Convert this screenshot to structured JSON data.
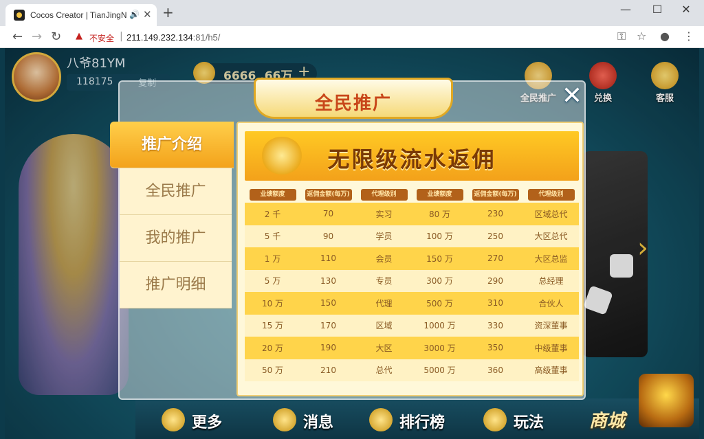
{
  "browser": {
    "tab_title": "Cocos Creator | TianJingNi",
    "url_warning": "不安全",
    "url_host": "211.149.232.134",
    "url_rest": ":81/h5/",
    "url_separator": "|"
  },
  "game": {
    "player": {
      "name": "八爷81YM",
      "id": "118175",
      "copy_label": "复制"
    },
    "coins": {
      "value": "6666 .66万",
      "plus": "+"
    },
    "top_buttons": [
      {
        "label": "全民推广"
      },
      {
        "label": "兑换"
      },
      {
        "label": "客服"
      }
    ],
    "bottom_nav": [
      {
        "label": "更多"
      },
      {
        "label": "消息"
      },
      {
        "label": "排行榜"
      },
      {
        "label": "玩法"
      },
      {
        "label": "商城"
      }
    ]
  },
  "modal": {
    "title": "全民推广",
    "menu": [
      "推广介绍",
      "全民推广",
      "我的推广",
      "推广明细"
    ],
    "active_menu_index": 0,
    "banner_title": "无限级流水返佣",
    "table": {
      "headers": [
        "业绩额度",
        "返佣金额(每万)",
        "代理级别",
        "业绩额度",
        "返佣金额(每万)",
        "代理级别"
      ],
      "rows": [
        [
          "2 千",
          "70",
          "实习",
          "80 万",
          "230",
          "区域总代"
        ],
        [
          "5 千",
          "90",
          "学员",
          "100 万",
          "250",
          "大区总代"
        ],
        [
          "1 万",
          "110",
          "会员",
          "150 万",
          "270",
          "大区总监"
        ],
        [
          "5 万",
          "130",
          "专员",
          "300 万",
          "290",
          "总经理"
        ],
        [
          "10 万",
          "150",
          "代理",
          "500 万",
          "310",
          "合伙人"
        ],
        [
          "15 万",
          "170",
          "区域",
          "1000 万",
          "330",
          "资深董事"
        ],
        [
          "20 万",
          "190",
          "大区",
          "3000 万",
          "350",
          "中级董事"
        ],
        [
          "50 万",
          "210",
          "总代",
          "5000 万",
          "360",
          "高级董事"
        ]
      ]
    }
  },
  "colors": {
    "accent_gold": "#f3a21b",
    "title_red": "#c8461a",
    "row_odd": "#ffd44a",
    "row_even": "#fff2c4"
  }
}
